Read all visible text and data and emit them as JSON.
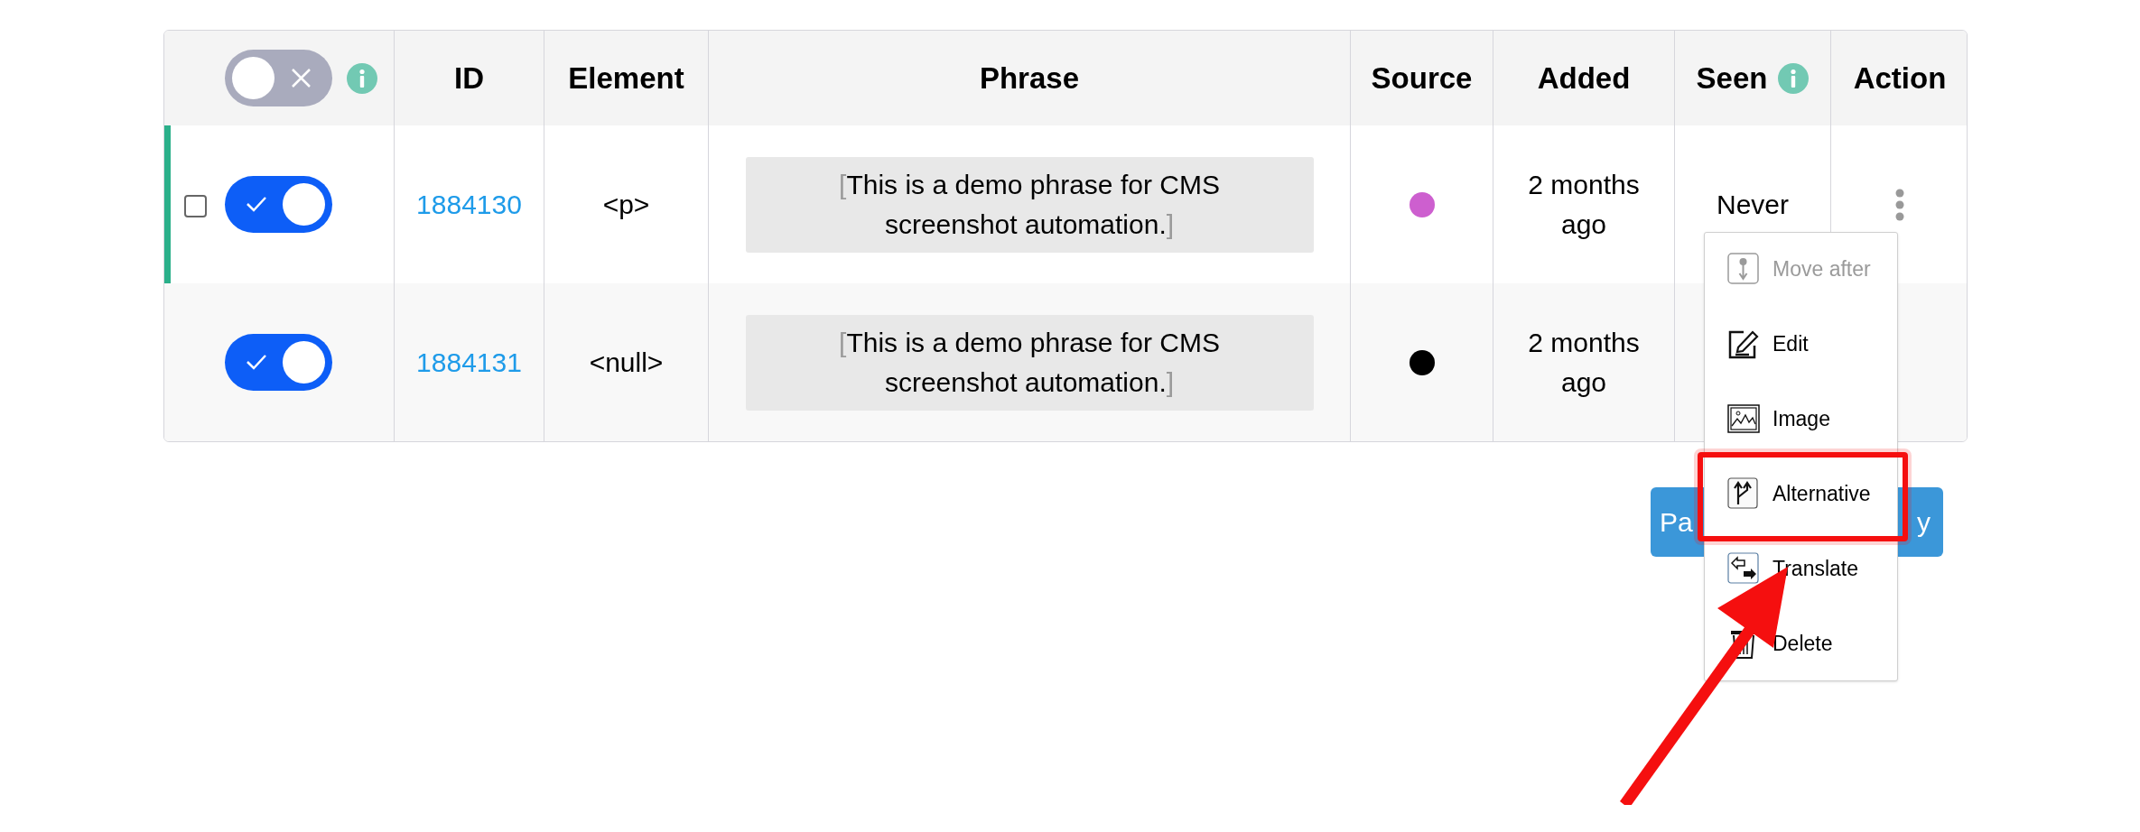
{
  "header_toggle": {
    "on": false,
    "info": true
  },
  "columns": [
    {
      "label": "ID",
      "info": false
    },
    {
      "label": "Element",
      "info": false
    },
    {
      "label": "Phrase",
      "info": false
    },
    {
      "label": "Source",
      "info": false
    },
    {
      "label": "Added",
      "info": false
    },
    {
      "label": "Seen",
      "info": true
    },
    {
      "label": "Action",
      "info": false
    }
  ],
  "rows": [
    {
      "active": true,
      "checked": false,
      "on": true,
      "id": "1884130",
      "element": "<p>",
      "phrase_open": "[",
      "phrase": "This is a demo phrase for CMS screenshot automation.",
      "phrase_close": "]",
      "color": "#cd5fcf",
      "added": "2 months ago",
      "seen": "Never"
    },
    {
      "active": false,
      "on": true,
      "id": "1884131",
      "element": "<null>",
      "phrase_open": "[",
      "phrase": "This is a demo phrase for CMS screenshot automation.",
      "phrase_close": "]",
      "color": "#000000",
      "added": "2 months ago"
    }
  ],
  "button": {
    "label_start": "Pa",
    "label_end": "y"
  },
  "menu": {
    "items": [
      {
        "kind": "move",
        "label": "Move after",
        "disabled": true,
        "highlighted": false
      },
      {
        "kind": "edit",
        "label": "Edit",
        "disabled": false,
        "highlighted": false
      },
      {
        "kind": "image",
        "label": "Image",
        "disabled": false,
        "highlighted": false
      },
      {
        "kind": "alternative",
        "label": "Alternative",
        "disabled": false,
        "highlighted": true
      },
      {
        "kind": "translate",
        "label": "Translate",
        "disabled": false,
        "highlighted": false
      },
      {
        "kind": "delete",
        "label": "Delete",
        "disabled": false,
        "highlighted": false
      }
    ]
  }
}
